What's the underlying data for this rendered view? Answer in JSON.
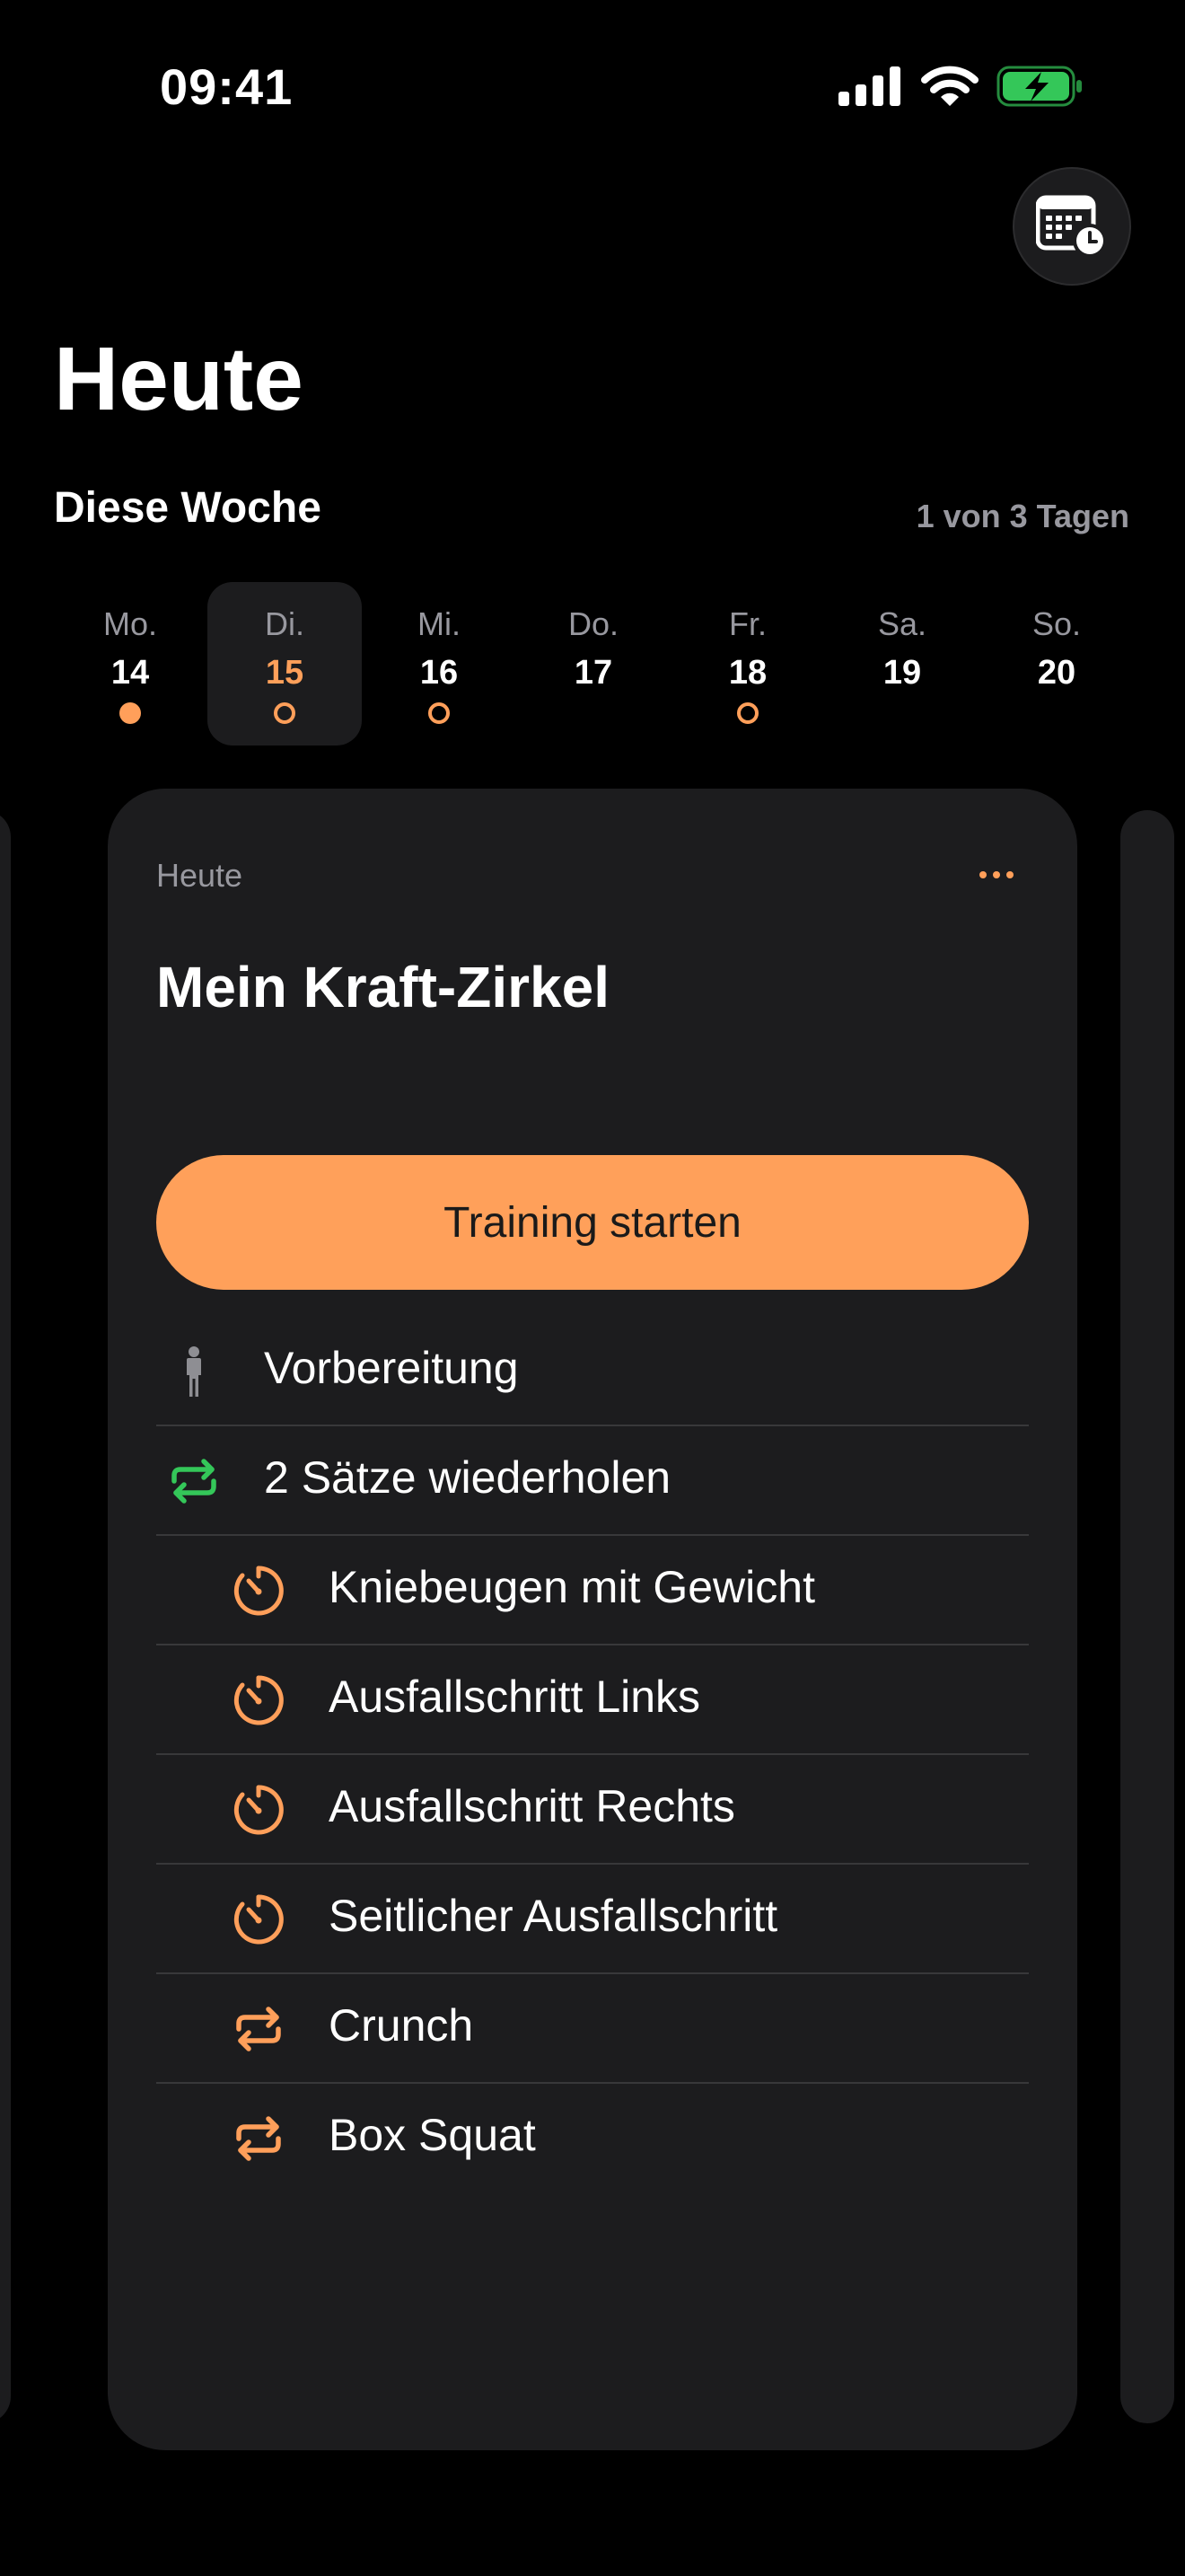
{
  "status_bar": {
    "time": "09:41"
  },
  "header": {
    "title": "Heute",
    "calendar_button_icon": "calendar-clock-icon"
  },
  "week": {
    "heading": "Diese Woche",
    "progress": "1 von 3 Tagen",
    "accent_color": "#ff9f5a",
    "days": [
      {
        "name": "Mo.",
        "num": "14",
        "dot": "filled",
        "selected": false
      },
      {
        "name": "Di.",
        "num": "15",
        "dot": "outline",
        "selected": true
      },
      {
        "name": "Mi.",
        "num": "16",
        "dot": "outline",
        "selected": false
      },
      {
        "name": "Do.",
        "num": "17",
        "dot": "none",
        "selected": false
      },
      {
        "name": "Fr.",
        "num": "18",
        "dot": "outline",
        "selected": false
      },
      {
        "name": "Sa.",
        "num": "19",
        "dot": "none",
        "selected": false
      },
      {
        "name": "So.",
        "num": "20",
        "dot": "none",
        "selected": false
      }
    ]
  },
  "card": {
    "eyebrow": "Heute",
    "more_icon": "ellipsis-icon",
    "title": "Mein Kraft-Zirkel",
    "start_label": "Training starten",
    "start_color": "#ffa05a",
    "steps": [
      {
        "label": "Vorbereitung",
        "icon": "person-standing-icon",
        "indent": false
      },
      {
        "label": "2 Sätze wiederholen",
        "icon": "repeat-icon",
        "indent": false
      },
      {
        "label": "Kniebeugen mit Gewicht",
        "icon": "timer-icon",
        "indent": true
      },
      {
        "label": "Ausfallschritt Links",
        "icon": "timer-icon",
        "indent": true
      },
      {
        "label": "Ausfallschritt Rechts",
        "icon": "timer-icon",
        "indent": true
      },
      {
        "label": "Seitlicher Ausfallschritt",
        "icon": "timer-icon",
        "indent": true
      },
      {
        "label": "Crunch",
        "icon": "repeat-icon",
        "indent": true
      },
      {
        "label": "Box Squat",
        "icon": "repeat-icon",
        "indent": true
      }
    ]
  }
}
